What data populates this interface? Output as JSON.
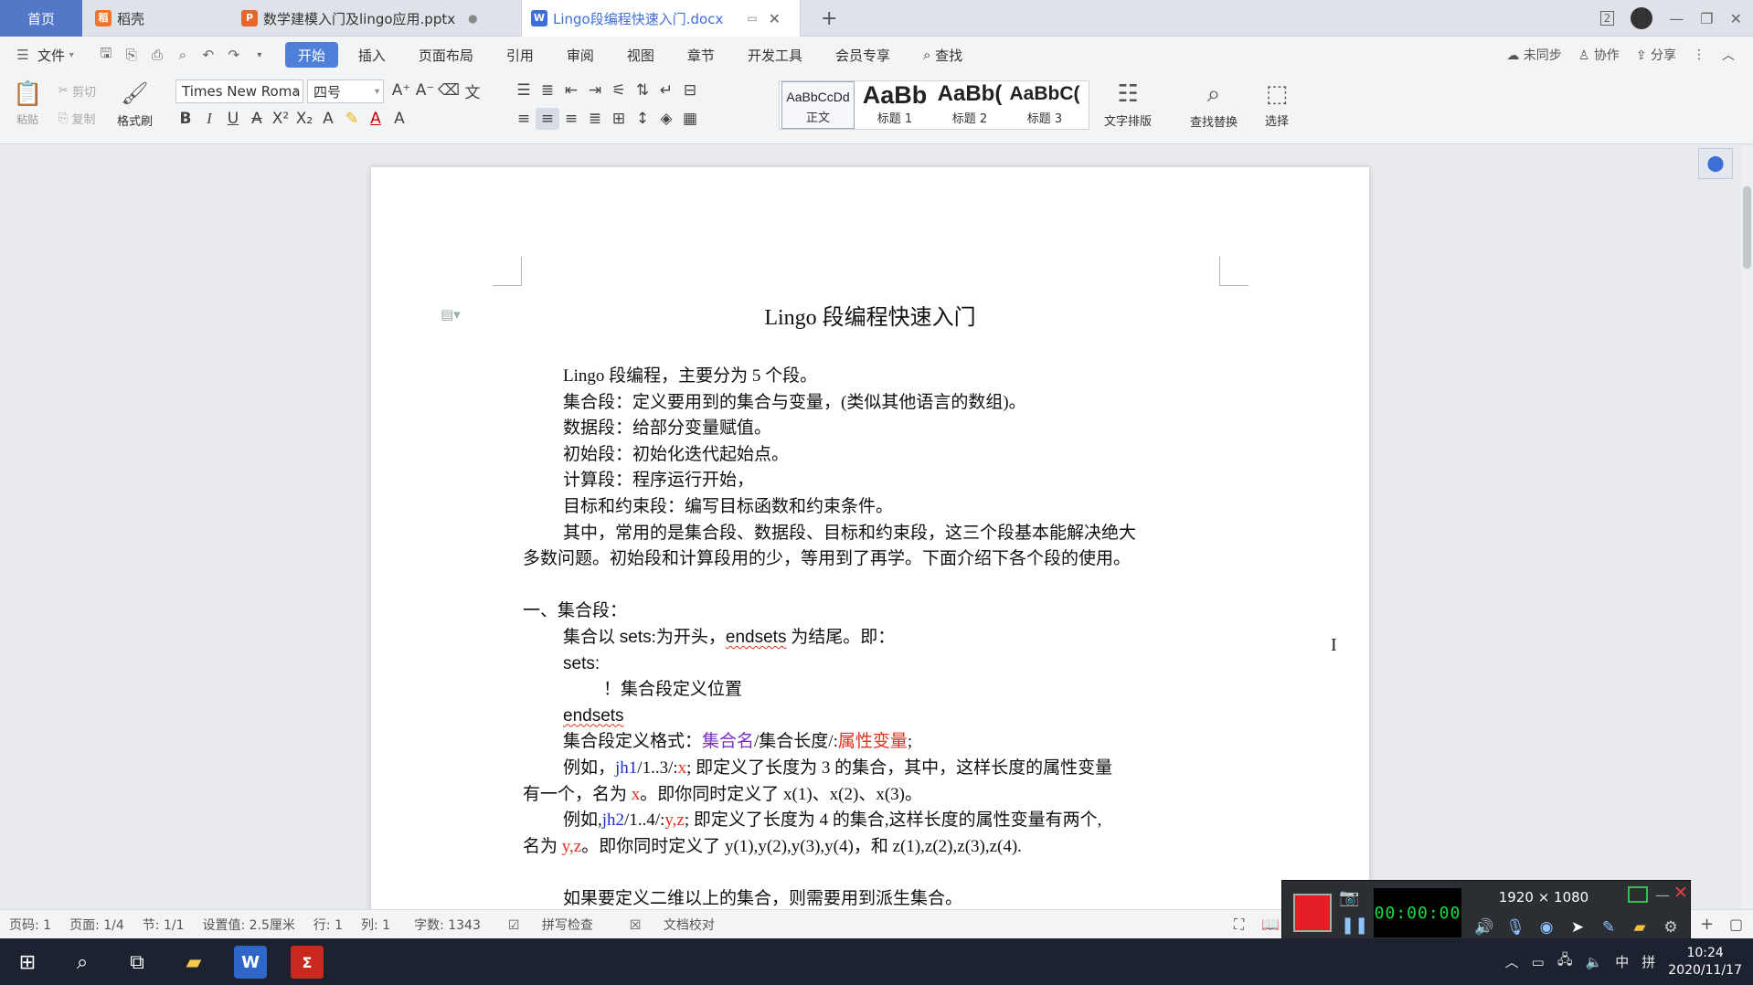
{
  "tabs": {
    "home": "首页",
    "daoke": "稻壳",
    "pptx": "数学建模入门及lingo应用.pptx",
    "docx": "Lingo段编程快速入门.docx",
    "add": "+"
  },
  "titlebar": {
    "badge": "2"
  },
  "menu": {
    "file": "文件",
    "items": [
      "开始",
      "插入",
      "页面布局",
      "引用",
      "审阅",
      "视图",
      "章节",
      "开发工具",
      "会员专享"
    ],
    "search": "查找",
    "unsynced": "未同步",
    "collab": "协作",
    "share": "分享"
  },
  "ribbon": {
    "paste": "粘贴",
    "cut": "剪切",
    "copy": "复制",
    "format_painter": "格式刷",
    "font_name": "Times New Roma",
    "font_size": "四号",
    "styles": [
      {
        "sample": "AaBbCcDd",
        "label": "正文"
      },
      {
        "sample": "AaBb",
        "label": "标题 1"
      },
      {
        "sample": "AaBb(",
        "label": "标题 2"
      },
      {
        "sample": "AaBbC(",
        "label": "标题 3"
      }
    ],
    "text_layout": "文字排版",
    "find_replace": "查找替换",
    "select": "选择"
  },
  "document": {
    "title": "Lingo 段编程快速入门",
    "intro": [
      "Lingo 段编程，主要分为 5 个段。",
      "集合段：定义要用到的集合与变量，(类似其他语言的数组)。",
      "数据段：给部分变量赋值。",
      "初始段：初始化迭代起始点。",
      "计算段：程序运行开始，",
      "目标和约束段：编写目标函数和约束条件。"
    ],
    "summary_1": "其中，常用的是集合段、数据段、目标和约束段，这三个段基本能解决绝大",
    "summary_2": "多数问题。初始段和计算段用的少，等用到了再学。下面介绍下各个段的使用。",
    "section1_heading": "一、集合段：",
    "sets_intro_a": "集合以 ",
    "sets_kw": "sets",
    "sets_intro_b": ":为开头，",
    "endsets_kw": "endsets",
    "sets_intro_c": " 为结尾。即：",
    "code_sets": "sets:",
    "code_comment": "！集合段定义位置",
    "code_endsets": "endsets",
    "format_label": "集合段定义格式：",
    "format_setname": "集合名",
    "format_mid": "/集合长度/:",
    "format_attr": "属性变量",
    "format_end": ";",
    "ex1_prefix": "例如，",
    "ex1_name": "jh1",
    "ex1_mid": "/1..3/:",
    "ex1_attr": "x",
    "ex1_rest": ";   即定义了长度为 3 的集合，其中，这样长度的属性变量",
    "ex1_line2_a": "有一个，名为 ",
    "ex1_line2_x": "x",
    "ex1_line2_b": "。即你同时定义了 x(1)、x(2)、x(3)。",
    "ex2_prefix": "例如,",
    "ex2_name": "jh2",
    "ex2_mid": "/1..4/:",
    "ex2_attr": "y,z",
    "ex2_rest": ";   即定义了长度为 4 的集合,这样长度的属性变量有两个,",
    "ex2_line2_a": "名为 ",
    "ex2_line2_yz": "y,z",
    "ex2_line2_b": "。即你同时定义了 y(1),y(2),y(3),y(4)，和 z(1),z(2),z(3),z(4).",
    "more": "如果要定义二维以上的集合，则需要用到派生集合。"
  },
  "status": {
    "page_code": "页码: 1",
    "pages": "页面: 1/4",
    "section": "节: 1/1",
    "setting": "设置值: 2.5厘米",
    "row": "行: 1",
    "col": "列: 1",
    "words": "字数: 1343",
    "spell": "拼写检查",
    "proof": "文档校对"
  },
  "recorder": {
    "resolution": "1920 × 1080",
    "timer": "00:00:00"
  },
  "taskbar": {
    "ime": "中",
    "time": "10:24",
    "date": "2020/11/17"
  },
  "colors": {
    "accent": "#4e7fd9",
    "home_tab": "#5478c8",
    "red_text": "#e0311f",
    "purple_text": "#7a2fbf",
    "blue_text": "#1d2fd0",
    "record": "#e41e25"
  }
}
